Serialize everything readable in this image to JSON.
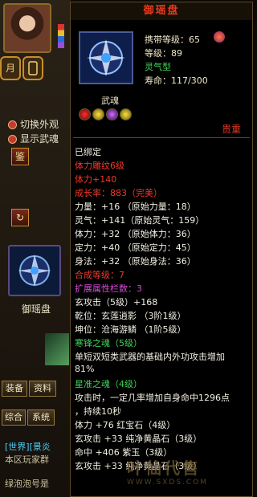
{
  "left": {
    "btn_month": "月",
    "option1": "切换外观",
    "option2": "显示武魂",
    "identify_btn": "鉴",
    "refresh_btn": "↻",
    "item_name": "御瑶盘",
    "tabs": [
      "装备",
      "资料"
    ],
    "chat_tabs": [
      "综合",
      "系统"
    ],
    "chat_channel": "[世界][景炎",
    "chat_line1": "本区玩家群",
    "chat_line2": "绿泡泡号是"
  },
  "tooltip": {
    "title": "御瑶盘",
    "carry_level": "携带等级：65",
    "level": "等级：89",
    "type": "灵气型",
    "life": "寿命：117/300",
    "soul_label": "武魂",
    "rarity": "贵重",
    "bound": "已绑定",
    "lines": [
      {
        "text": "体力雕纹6级",
        "color": "red"
      },
      {
        "text": "体力+140",
        "color": "red"
      },
      {
        "text": "成长率：883（完美）",
        "color": "red"
      },
      {
        "text": "力量：+16 （原始力量：18）",
        "color": "white"
      },
      {
        "text": "灵气：+141（原始灵气：159）",
        "color": "white"
      },
      {
        "text": "体力：+32 （原始体力：36）",
        "color": "white"
      },
      {
        "text": "定力：+40 （原始定力：45）",
        "color": "white"
      },
      {
        "text": "身法：+32 （原始身法：36）",
        "color": "white"
      },
      {
        "text": "合成等级：7",
        "color": "red"
      },
      {
        "text": "扩展属性栏数：3",
        "color": "violet"
      },
      {
        "text": "玄攻击（5级）+168",
        "color": "white"
      },
      {
        "text": "乾位：玄莲逍影 （3阶1级）",
        "color": "white"
      },
      {
        "text": "坤位：沧海游鳞 （1阶5级）",
        "color": "white"
      },
      {
        "text": "寒锋之魂（5级）",
        "color": "green"
      },
      {
        "text": "单短双短类武器的基础内外功攻击增加",
        "color": "white"
      },
      {
        "text": "81%",
        "color": "white"
      },
      {
        "text": "星准之魂（4级）",
        "color": "green"
      },
      {
        "text": "攻击时，一定几率增加自身命中1296点",
        "color": "white"
      },
      {
        "text": "，持续10秒",
        "color": "white"
      },
      {
        "text": "体力 +76 红宝石（4级）",
        "color": "white"
      },
      {
        "text": "玄攻击 +33 纯净黄晶石（3级）",
        "color": "white"
      },
      {
        "text": "命中 +406 紫玉（3级）",
        "color": "white"
      },
      {
        "text": "玄攻击 +33 纯净黄晶石（3级）",
        "color": "white"
      }
    ]
  },
  "watermark": {
    "brand": "叶仙代售",
    "url": "WWW.SXDS.COM"
  },
  "colors": {
    "white": "#f2efe2",
    "red": "#f03828",
    "violet": "#d84ad8",
    "green": "#42d45a",
    "gold": "#d8a43a"
  }
}
